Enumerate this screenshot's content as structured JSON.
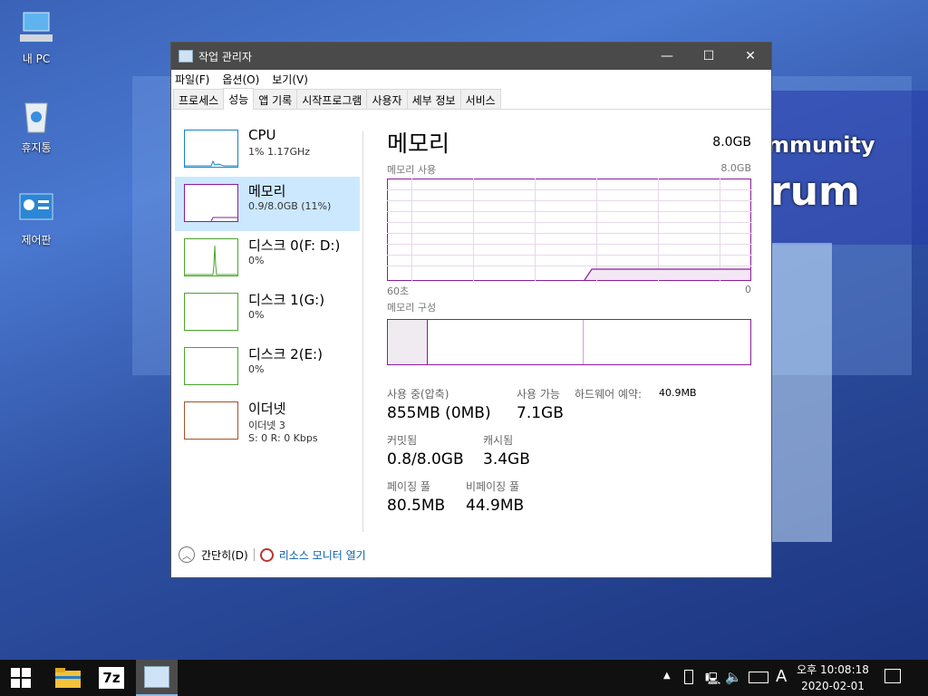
{
  "desktop": {
    "icons": [
      {
        "label": "내 PC"
      },
      {
        "label": "휴지통"
      },
      {
        "label": "제어판"
      }
    ],
    "wallpaper_text": {
      "line1": "mmunity",
      "line2": "rum"
    }
  },
  "window": {
    "title": "작업 관리자",
    "controls": {
      "minimize": "—",
      "maximize": "☐",
      "close": "✕"
    },
    "menu": [
      "파일(F)",
      "옵션(O)",
      "보기(V)"
    ],
    "tabs": [
      "프로세스",
      "성능",
      "앱 기록",
      "시작프로그램",
      "사용자",
      "세부 정보",
      "서비스"
    ],
    "active_tab": "성능",
    "sidebar": [
      {
        "name": "CPU",
        "sub": "1% 1.17GHz",
        "sub2": "",
        "color": "#1a82c6"
      },
      {
        "name": "메모리",
        "sub": "0.9/8.0GB (11%)",
        "sub2": "",
        "color": "#8b1d9a"
      },
      {
        "name": "디스크 0(F: D:)",
        "sub": "0%",
        "sub2": "",
        "color": "#4aa52c"
      },
      {
        "name": "디스크 1(G:)",
        "sub": "0%",
        "sub2": "",
        "color": "#4aa52c"
      },
      {
        "name": "디스크 2(E:)",
        "sub": "0%",
        "sub2": "",
        "color": "#4aa52c"
      },
      {
        "name": "이더넷",
        "sub": "이더넷 3",
        "sub2": "S: 0  R: 0 Kbps",
        "color": "#a0522d"
      }
    ],
    "main": {
      "title": "메모리",
      "total": "8.0GB",
      "usage_label": "메모리 사용",
      "usage_max": "8.0GB",
      "time_left": "60초",
      "time_right": "0",
      "composition_label": "메모리 구성",
      "usage_fraction": 0.11,
      "stats": {
        "in_use_label": "사용 중(압축)",
        "in_use": "855MB (0MB)",
        "available_label": "사용 가능",
        "available": "7.1GB",
        "hw_reserved_label": "하드웨어 예약:",
        "hw_reserved": "40.9MB",
        "committed_label": "커밋됨",
        "committed": "0.8/8.0GB",
        "cached_label": "캐시됨",
        "cached": "3.4GB",
        "paged_label": "페이징 풀",
        "paged": "80.5MB",
        "nonpaged_label": "비페이징 풀",
        "nonpaged": "44.9MB"
      }
    },
    "footer": {
      "collapse": "간단히(D)",
      "resmon": "리소스 모니터 열기"
    }
  },
  "taskbar": {
    "time": "오후 10:08:18",
    "date": "2020-02-01",
    "ime": "A"
  }
}
